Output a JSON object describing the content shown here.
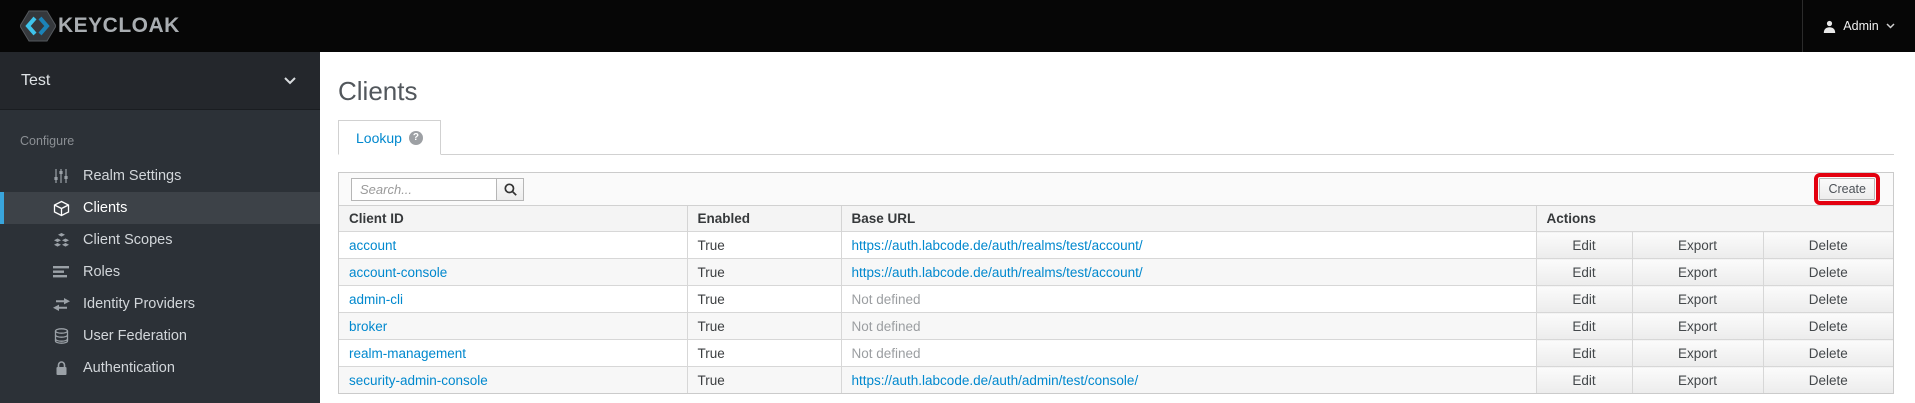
{
  "topbar": {
    "brand": "KEYCLOAK",
    "user": {
      "label": "Admin",
      "icon": "user-icon",
      "caret": "chevron-down-icon"
    }
  },
  "sidebar": {
    "realm": "Test",
    "realm_caret": "chevron-down-icon",
    "section_label": "Configure",
    "items": [
      {
        "label": "Realm Settings",
        "icon": "sliders-icon",
        "active": false
      },
      {
        "label": "Clients",
        "icon": "cube-icon",
        "active": true
      },
      {
        "label": "Client Scopes",
        "icon": "cubes-icon",
        "active": false
      },
      {
        "label": "Roles",
        "icon": "list-icon",
        "active": false
      },
      {
        "label": "Identity Providers",
        "icon": "exchange-icon",
        "active": false
      },
      {
        "label": "User Federation",
        "icon": "database-icon",
        "active": false
      },
      {
        "label": "Authentication",
        "icon": "lock-icon",
        "active": false
      }
    ]
  },
  "main": {
    "title": "Clients",
    "tab": {
      "label": "Lookup",
      "help_glyph": "?"
    },
    "toolbar": {
      "search_placeholder": "Search...",
      "search_icon": "search-icon",
      "create_label": "Create",
      "create_annotation_color": "#e3000f"
    },
    "table": {
      "headers": [
        "Client ID",
        "Enabled",
        "Base URL",
        "Actions"
      ],
      "action_labels": [
        "Edit",
        "Export",
        "Delete"
      ],
      "rows": [
        {
          "client_id": "account",
          "enabled": "True",
          "base_url": "https://auth.labcode.de/auth/realms/test/account/",
          "base_url_is_link": true
        },
        {
          "client_id": "account-console",
          "enabled": "True",
          "base_url": "https://auth.labcode.de/auth/realms/test/account/",
          "base_url_is_link": true
        },
        {
          "client_id": "admin-cli",
          "enabled": "True",
          "base_url": "Not defined",
          "base_url_is_link": false
        },
        {
          "client_id": "broker",
          "enabled": "True",
          "base_url": "Not defined",
          "base_url_is_link": false
        },
        {
          "client_id": "realm-management",
          "enabled": "True",
          "base_url": "Not defined",
          "base_url_is_link": false
        },
        {
          "client_id": "security-admin-console",
          "enabled": "True",
          "base_url": "https://auth.labcode.de/auth/admin/test/console/",
          "base_url_is_link": true
        }
      ]
    }
  },
  "colors": {
    "accent_blue": "#39a5dc",
    "link_blue": "#0088ce",
    "annotation_red": "#e3000f"
  }
}
